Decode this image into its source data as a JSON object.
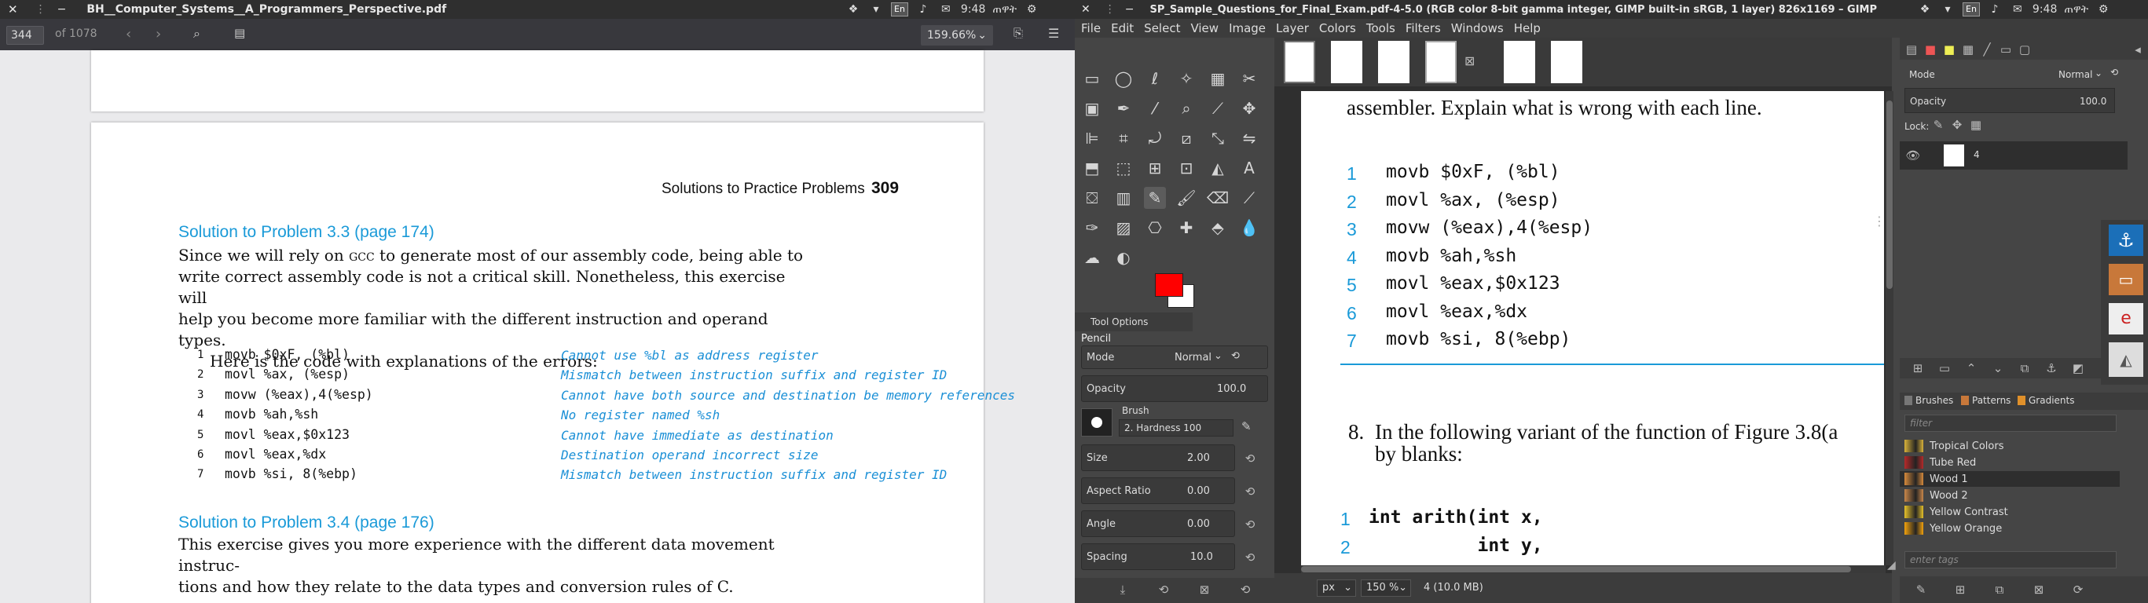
{
  "left": {
    "title": "BH__Computer_Systems__A_Programmers_Perspective.pdf",
    "time": "9:48",
    "ampm": "ጠዋት",
    "lang": "En",
    "page_value": "344",
    "page_of": "of 1078",
    "zoom": "159.66%",
    "header_title": "Solutions to Practice Problems",
    "header_page": "309",
    "sol33_title": "Solution to Problem 3.3 (page 174)",
    "sol33_para": [
      "Since we will rely on ",
      "gcc",
      " to generate most of our assembly code, being able to",
      "write correct assembly code is not a critical skill. Nonetheless, this exercise will",
      "help you become more familiar with the different instruction and operand types."
    ],
    "sol33_para2": "Here is the code with explanations of the errors:",
    "code_lines": [
      {
        "n": "1",
        "code": "movb $0xF, (%bl)",
        "comment": "Cannot use %bl as address register"
      },
      {
        "n": "2",
        "code": "movl %ax, (%esp)",
        "comment": "Mismatch between instruction suffix and register ID"
      },
      {
        "n": "3",
        "code": "movw (%eax),4(%esp)",
        "comment": "Cannot have both source and destination be memory references"
      },
      {
        "n": "4",
        "code": "movb %ah,%sh",
        "comment": "No register named %sh"
      },
      {
        "n": "5",
        "code": "movl %eax,$0x123",
        "comment": "Cannot have immediate as destination"
      },
      {
        "n": "6",
        "code": "movl %eax,%dx",
        "comment": "Destination operand incorrect size"
      },
      {
        "n": "7",
        "code": "movb %si, 8(%ebp)",
        "comment": "Mismatch between instruction suffix and register ID"
      }
    ],
    "sol34_title": "Solution to Problem 3.4 (page 176)",
    "sol34_para": [
      "This exercise gives you more experience with the different data movement instruc-",
      "tions and how they relate to the data types and conversion rules of C."
    ]
  },
  "right": {
    "title": "SP_Sample_Questions_for_Final_Exam.pdf-4-5.0 (RGB color 8-bit gamma integer, GIMP built-in sRGB, 1 layer) 826x1169 – GIMP",
    "time": "9:48",
    "ampm": "ጠዋት",
    "lang": "En",
    "menu": [
      "File",
      "Edit",
      "Select",
      "View",
      "Image",
      "Layer",
      "Colors",
      "Tools",
      "Filters",
      "Windows",
      "Help"
    ],
    "fg_color": "#ff0000",
    "bg_color": "#ffffff",
    "tool_options_tab": "Tool Options",
    "tool_name": "Pencil",
    "mode_label": "Mode",
    "mode_value": "Normal",
    "opacity_label": "Opacity",
    "opacity_value": "100.0",
    "brush_label": "Brush",
    "brush_value": "2. Hardness 100",
    "size_label": "Size",
    "size_value": "2.00",
    "aspect_label": "Aspect Ratio",
    "aspect_value": "0.00",
    "angle_label": "Angle",
    "angle_value": "0.00",
    "spacing_label": "Spacing",
    "spacing_value": "10.0",
    "canvas": {
      "line_top": "assembler. Explain what is wrong with each line.",
      "code": [
        {
          "n": "1",
          "code": "movb $0xF, (%bl)"
        },
        {
          "n": "2",
          "code": "movl %ax, (%esp)"
        },
        {
          "n": "3",
          "code": "movw (%eax),4(%esp)"
        },
        {
          "n": "4",
          "code": "movb %ah,%sh"
        },
        {
          "n": "5",
          "code": "movl %eax,$0x123"
        },
        {
          "n": "6",
          "code": "movl %eax,%dx"
        },
        {
          "n": "7",
          "code": "movb %si, 8(%ebp)"
        }
      ],
      "q8_num": "8.",
      "q8_line1": "In the following variant of the function of Figure 3.8(a",
      "q8_line2": "by blanks:",
      "code2": [
        {
          "n": "1",
          "code": "int arith(int x,"
        },
        {
          "n": "2",
          "code": "          int y,"
        }
      ]
    },
    "status_unit": "px",
    "status_zoom": "150 %",
    "status_info": "4 (10.0 MB)",
    "layers_mode_label": "Mode",
    "layers_mode_value": "Normal",
    "layers_opacity_label": "Opacity",
    "layers_opacity_value": "100.0",
    "lock_label": "Lock:",
    "layer_name": "4",
    "tabs": [
      "Brushes",
      "Patterns",
      "Gradients"
    ],
    "filter_placeholder": "filter",
    "gradients": [
      {
        "name": "Tropical Colors",
        "color": "#d8b23a"
      },
      {
        "name": "Tube Red",
        "color": "#b52a2a"
      },
      {
        "name": "Wood 1",
        "color": "#d68a3c"
      },
      {
        "name": "Wood 2",
        "color": "#c9874a"
      },
      {
        "name": "Yellow Contrast",
        "color": "#e6c12a"
      },
      {
        "name": "Yellow Orange",
        "color": "#f2a20e"
      }
    ],
    "tags_placeholder": "enter tags"
  }
}
